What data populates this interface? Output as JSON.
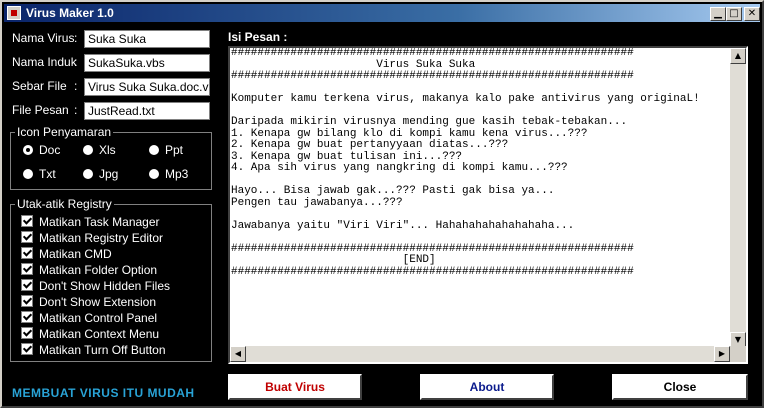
{
  "window": {
    "title": "Virus Maker 1.0"
  },
  "form": {
    "nama_virus": {
      "label": "Nama Virus",
      "value": "Suka Suka"
    },
    "nama_induk": {
      "label": "Nama Induk",
      "value": "SukaSuka.vbs"
    },
    "sebar_file": {
      "label": "Sebar File",
      "value": "Virus Suka Suka.doc.vbs"
    },
    "file_pesan": {
      "label": "File Pesan",
      "value": "JustRead.txt"
    },
    "colon": ":"
  },
  "icon_group": {
    "title": "Icon Penyamaran",
    "options": [
      {
        "label": "Doc",
        "selected": true
      },
      {
        "label": "Xls",
        "selected": false
      },
      {
        "label": "Ppt",
        "selected": false
      },
      {
        "label": "Txt",
        "selected": false
      },
      {
        "label": "Jpg",
        "selected": false
      },
      {
        "label": "Mp3",
        "selected": false
      }
    ]
  },
  "registry_group": {
    "title": "Utak-atik Registry",
    "items": [
      {
        "label": "Matikan Task Manager",
        "checked": true
      },
      {
        "label": "Matikan Registry Editor",
        "checked": true
      },
      {
        "label": "Matikan CMD",
        "checked": true
      },
      {
        "label": "Matikan Folder Option",
        "checked": true
      },
      {
        "label": "Don't Show Hidden Files",
        "checked": true
      },
      {
        "label": "Don't Show Extension",
        "checked": true
      },
      {
        "label": "Matikan Control Panel",
        "checked": true
      },
      {
        "label": "Matikan Context Menu",
        "checked": true
      },
      {
        "label": "Matikan Turn Off Button",
        "checked": true
      }
    ]
  },
  "slogan": "MEMBUAT VIRUS ITU MUDAH",
  "isi_pesan": {
    "label": "Isi Pesan   :",
    "text": "#############################################################\n                      Virus Suka Suka\n#############################################################\n\nKomputer kamu terkena virus, makanya kalo pake antivirus yang originaL!\n\nDaripada mikirin virusnya mending gue kasih tebak-tebakan...\n1. Kenapa gw bilang klo di kompi kamu kena virus...???\n2. Kenapa gw buat pertanyyaan diatas...???\n3. Kenapa gw buat tulisan ini...???\n4. Apa sih virus yang nangkring di kompi kamu...???\n\nHayo... Bisa jawab gak...??? Pasti gak bisa ya...\nPengen tau jawabanya...???\n\nJawabanya yaitu \"Viri Viri\"... Hahahahahahahahaha...\n\n#############################################################\n                          [END]\n#############################################################"
  },
  "buttons": {
    "buat_virus": {
      "label": "Buat Virus",
      "color": "#c00000"
    },
    "about": {
      "label": "About",
      "color": "#0a1a8c"
    },
    "close": {
      "label": "Close",
      "color": "#000000"
    }
  },
  "icons": {
    "minimize": "minimize-icon",
    "maximize": "maximize-icon",
    "close": "close-icon"
  },
  "colors": {
    "title_bar": "#0a246a",
    "slogan": "#29a3d6",
    "background": "#000000"
  }
}
